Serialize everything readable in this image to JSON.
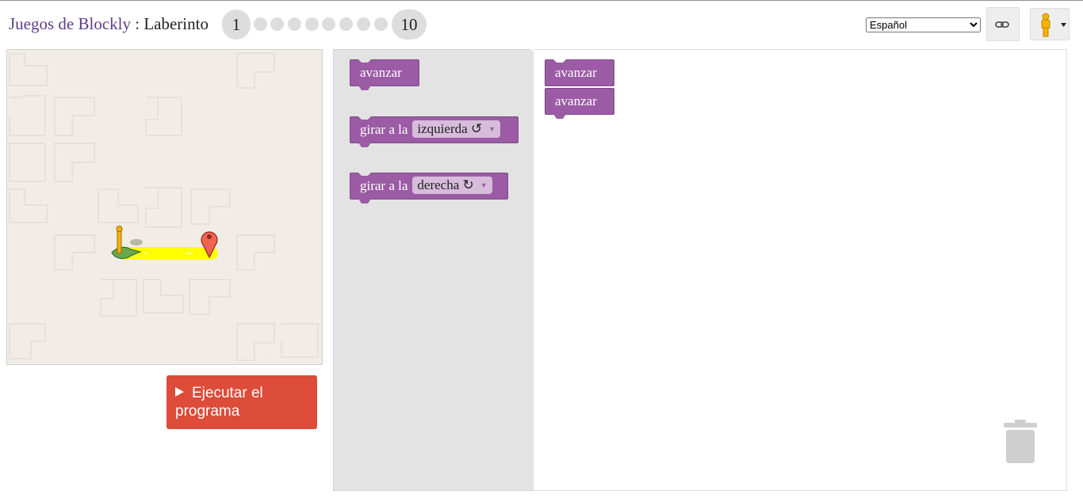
{
  "header": {
    "games_label": "Juegos de Blockly",
    "separator": ":",
    "game_name": "Laberinto",
    "levels": {
      "first": "1",
      "last": "10",
      "current": 1,
      "total": 10
    },
    "language": {
      "selected": "Español",
      "options": [
        "Español"
      ]
    },
    "link_icon": "link-icon",
    "pegman_icon": "pegman-icon"
  },
  "maze": {
    "start_icon": "pegman-start-icon",
    "goal_icon": "goal-marker-icon",
    "path_color": "#ffff00"
  },
  "run_button": {
    "label": "Ejecutar el programa",
    "icon": "play-icon",
    "color": "#dd4b39"
  },
  "toolbox": {
    "blocks": [
      {
        "label": "avanzar"
      },
      {
        "label": "girar a la",
        "dropdown": "izquierda ↺"
      },
      {
        "label": "girar a la",
        "dropdown": "derecha ↻"
      }
    ]
  },
  "workspace": {
    "blocks": [
      {
        "label": "avanzar"
      },
      {
        "label": "avanzar"
      }
    ],
    "trash_icon": "trash-icon"
  },
  "colors": {
    "block": "#9b5ba5",
    "accent": "#5e3c8c"
  }
}
